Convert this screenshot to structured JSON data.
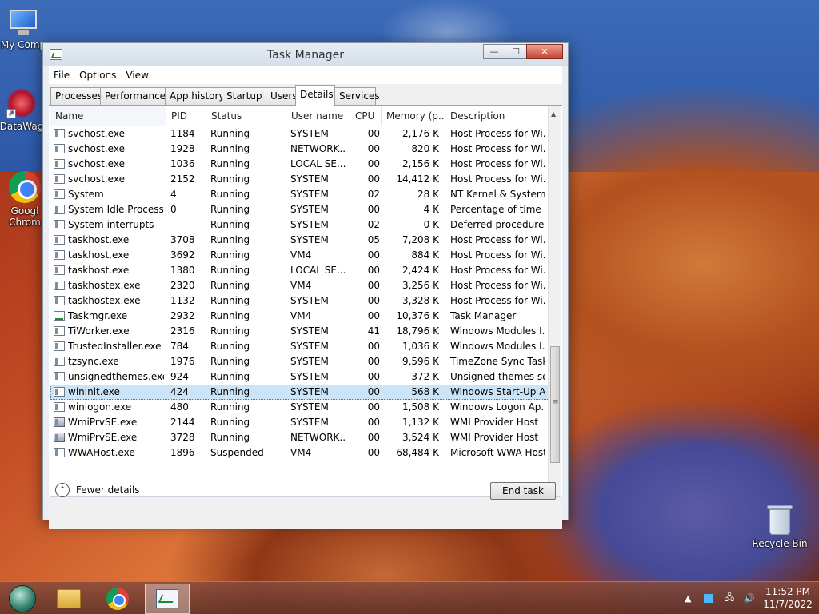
{
  "desktop": {
    "icons": [
      {
        "label": "My Comp"
      },
      {
        "label": "DataWag"
      },
      {
        "label": "Googl Chrom"
      },
      {
        "label": "Recycle Bin"
      }
    ]
  },
  "window": {
    "title": "Task Manager",
    "controls": {
      "minimize": "—",
      "maximize": "☐",
      "close": "✕"
    }
  },
  "menu": [
    "File",
    "Options",
    "View"
  ],
  "tabs": [
    "Processes",
    "Performance",
    "App history",
    "Startup",
    "Users",
    "Details",
    "Services"
  ],
  "active_tab": "Details",
  "columns": [
    "Name",
    "PID",
    "Status",
    "User name",
    "CPU",
    "Memory (p...",
    "Description"
  ],
  "rows": [
    {
      "name": "svchost.exe",
      "pid": "1184",
      "status": "Running",
      "user": "SYSTEM",
      "cpu": "00",
      "mem": "2,176 K",
      "desc": "Host Process for Wi..."
    },
    {
      "name": "svchost.exe",
      "pid": "1928",
      "status": "Running",
      "user": "NETWORK...",
      "cpu": "00",
      "mem": "820 K",
      "desc": "Host Process for Wi..."
    },
    {
      "name": "svchost.exe",
      "pid": "1036",
      "status": "Running",
      "user": "LOCAL SE...",
      "cpu": "00",
      "mem": "2,156 K",
      "desc": "Host Process for Wi..."
    },
    {
      "name": "svchost.exe",
      "pid": "2152",
      "status": "Running",
      "user": "SYSTEM",
      "cpu": "00",
      "mem": "14,412 K",
      "desc": "Host Process for Wi..."
    },
    {
      "name": "System",
      "pid": "4",
      "status": "Running",
      "user": "SYSTEM",
      "cpu": "02",
      "mem": "28 K",
      "desc": "NT Kernel & System"
    },
    {
      "name": "System Idle Process",
      "pid": "0",
      "status": "Running",
      "user": "SYSTEM",
      "cpu": "00",
      "mem": "4 K",
      "desc": "Percentage of time t..."
    },
    {
      "name": "System interrupts",
      "pid": "-",
      "status": "Running",
      "user": "SYSTEM",
      "cpu": "02",
      "mem": "0 K",
      "desc": "Deferred procedure ..."
    },
    {
      "name": "taskhost.exe",
      "pid": "3708",
      "status": "Running",
      "user": "SYSTEM",
      "cpu": "05",
      "mem": "7,208 K",
      "desc": "Host Process for Wi..."
    },
    {
      "name": "taskhost.exe",
      "pid": "3692",
      "status": "Running",
      "user": "VM4",
      "cpu": "00",
      "mem": "884 K",
      "desc": "Host Process for Wi..."
    },
    {
      "name": "taskhost.exe",
      "pid": "1380",
      "status": "Running",
      "user": "LOCAL SE...",
      "cpu": "00",
      "mem": "2,424 K",
      "desc": "Host Process for Wi..."
    },
    {
      "name": "taskhostex.exe",
      "pid": "2320",
      "status": "Running",
      "user": "VM4",
      "cpu": "00",
      "mem": "3,256 K",
      "desc": "Host Process for Wi..."
    },
    {
      "name": "taskhostex.exe",
      "pid": "1132",
      "status": "Running",
      "user": "SYSTEM",
      "cpu": "00",
      "mem": "3,328 K",
      "desc": "Host Process for Wi..."
    },
    {
      "name": "Taskmgr.exe",
      "pid": "2932",
      "status": "Running",
      "user": "VM4",
      "cpu": "00",
      "mem": "10,376 K",
      "desc": "Task Manager"
    },
    {
      "name": "TiWorker.exe",
      "pid": "2316",
      "status": "Running",
      "user": "SYSTEM",
      "cpu": "41",
      "mem": "18,796 K",
      "desc": "Windows Modules I..."
    },
    {
      "name": "TrustedInstaller.exe",
      "pid": "784",
      "status": "Running",
      "user": "SYSTEM",
      "cpu": "00",
      "mem": "1,036 K",
      "desc": "Windows Modules I..."
    },
    {
      "name": "tzsync.exe",
      "pid": "1976",
      "status": "Running",
      "user": "SYSTEM",
      "cpu": "00",
      "mem": "9,596 K",
      "desc": "TimeZone Sync Task"
    },
    {
      "name": "unsignedthemes.exe",
      "pid": "924",
      "status": "Running",
      "user": "SYSTEM",
      "cpu": "00",
      "mem": "372 K",
      "desc": "Unsigned themes se..."
    },
    {
      "name": "wininit.exe",
      "pid": "424",
      "status": "Running",
      "user": "SYSTEM",
      "cpu": "00",
      "mem": "568 K",
      "desc": "Windows Start-Up A..."
    },
    {
      "name": "winlogon.exe",
      "pid": "480",
      "status": "Running",
      "user": "SYSTEM",
      "cpu": "00",
      "mem": "1,508 K",
      "desc": "Windows Logon Ap..."
    },
    {
      "name": "WmiPrvSE.exe",
      "pid": "2144",
      "status": "Running",
      "user": "SYSTEM",
      "cpu": "00",
      "mem": "1,132 K",
      "desc": "WMI Provider Host"
    },
    {
      "name": "WmiPrvSE.exe",
      "pid": "3728",
      "status": "Running",
      "user": "NETWORK...",
      "cpu": "00",
      "mem": "3,524 K",
      "desc": "WMI Provider Host"
    },
    {
      "name": "WWAHost.exe",
      "pid": "1896",
      "status": "Suspended",
      "user": "VM4",
      "cpu": "00",
      "mem": "68,484 K",
      "desc": "Microsoft WWA Host"
    }
  ],
  "selected_row": "wininit.exe",
  "footer": {
    "fewer_details": "Fewer details",
    "end_task": "End task"
  },
  "taskbar": {
    "time": "11:52 PM",
    "date": "11/7/2022"
  },
  "colors": {
    "selection": "#cce4f7",
    "taskbar": "#7a4438"
  }
}
